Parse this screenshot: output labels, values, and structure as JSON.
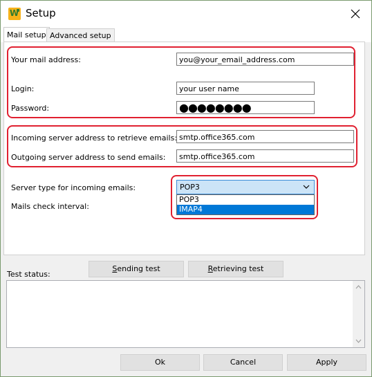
{
  "window": {
    "title": "Setup"
  },
  "tabs": [
    {
      "label": "Mail setup",
      "active": true
    },
    {
      "label": "Advanced setup",
      "active": false
    }
  ],
  "mail": {
    "address_label": "Your mail address:",
    "address_value": "you@your_email_address.com",
    "login_label": "Login:",
    "login_value": "your user name",
    "password_label": "Password:",
    "password_value": "●●●●●●●●"
  },
  "servers": {
    "incoming_label": "Incoming server address to retrieve emails:",
    "incoming_value": "smtp.office365.com",
    "outgoing_label": "Outgoing server address to send emails:",
    "outgoing_value": "smtp.office365.com"
  },
  "server_type": {
    "label": "Server type for incoming emails:",
    "selected": "POP3",
    "options": [
      "POP3",
      "IMAP4"
    ],
    "highlighted_option": "IMAP4"
  },
  "check_interval": {
    "label": "Mails check interval:"
  },
  "tests": {
    "sending_label_prefix": "S",
    "sending_label_rest": "ending test",
    "retrieving_label_prefix": "R",
    "retrieving_label_rest": "etrieving test"
  },
  "status": {
    "label": "Test status:",
    "text": ""
  },
  "footer": {
    "ok_label": "Ok",
    "cancel_label": "Cancel",
    "apply_label": "Apply"
  },
  "colors": {
    "highlight_border": "#e02030",
    "selection": "#0078d7",
    "select_bg": "#cce4f7"
  }
}
